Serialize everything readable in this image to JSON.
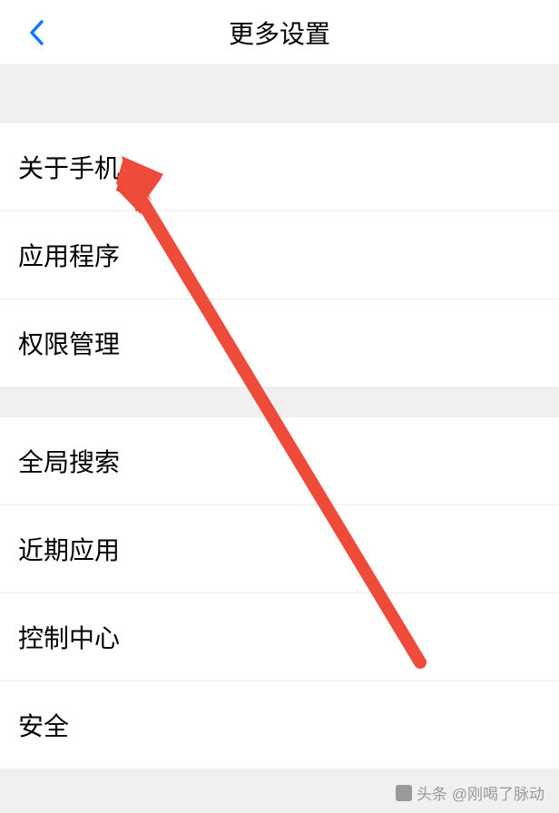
{
  "header": {
    "title": "更多设置"
  },
  "groups": [
    {
      "items": [
        {
          "label": "关于手机",
          "key": "about-phone"
        },
        {
          "label": "应用程序",
          "key": "applications"
        },
        {
          "label": "权限管理",
          "key": "permissions"
        }
      ]
    },
    {
      "items": [
        {
          "label": "全局搜索",
          "key": "global-search"
        },
        {
          "label": "近期应用",
          "key": "recent-apps"
        },
        {
          "label": "控制中心",
          "key": "control-center"
        },
        {
          "label": "安全",
          "key": "security"
        }
      ]
    }
  ],
  "watermark": {
    "text": "头条 @刚喝了脉动"
  }
}
